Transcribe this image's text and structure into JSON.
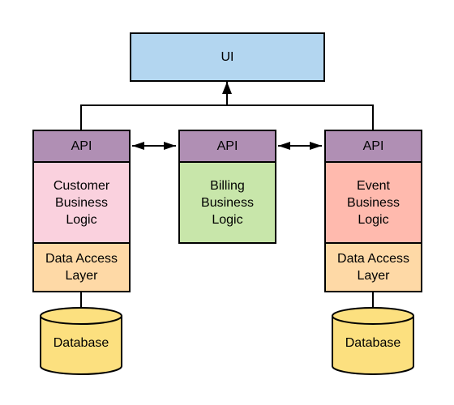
{
  "ui": {
    "label": "UI",
    "color": "#b3d6f0"
  },
  "services": [
    {
      "api": "API",
      "logic": "Customer\nBusiness\nLogic",
      "logic_color": "#fad1de",
      "dal": "Data Access\nLayer",
      "database": "Database"
    },
    {
      "api": "API",
      "logic": "Billing\nBusiness\nLogic",
      "logic_color": "#c8e6aa"
    },
    {
      "api": "API",
      "logic": "Event\nBusiness\nLogic",
      "logic_color": "#ffbaae",
      "dal": "Data Access\nLayer",
      "database": "Database"
    }
  ],
  "colors": {
    "api": "#b08fb4",
    "dal": "#fed9a6",
    "database": "#fce07f"
  }
}
